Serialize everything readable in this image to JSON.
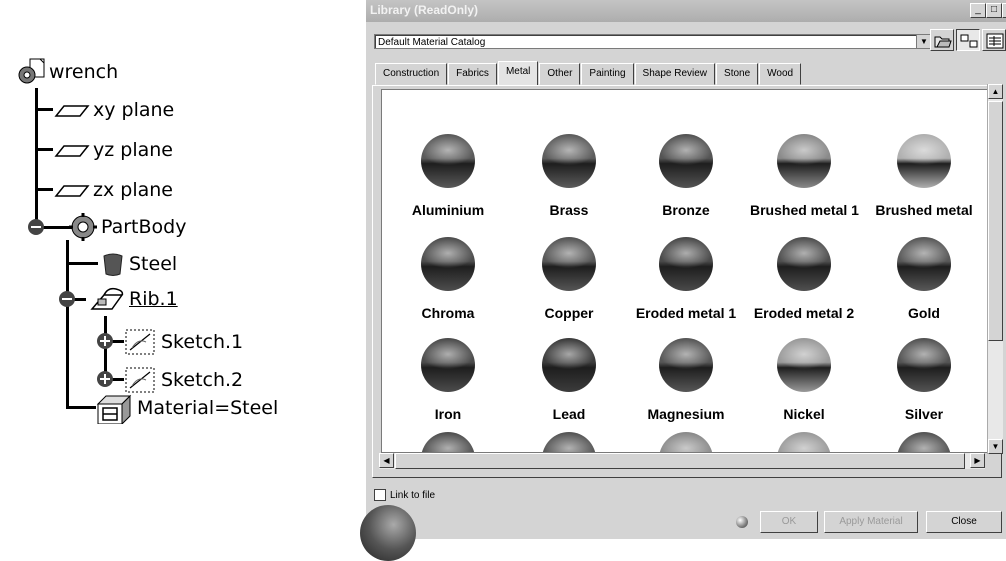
{
  "tree": {
    "root": "wrench",
    "planes": [
      "xy plane",
      "yz plane",
      "zx plane"
    ],
    "partbody": "PartBody",
    "steel": "Steel",
    "rib": "Rib.1",
    "sketches": [
      "Sketch.1",
      "Sketch.2"
    ],
    "material": "Material=Steel"
  },
  "dialog": {
    "title": "Library (ReadOnly)",
    "catalog": "Default Material Catalog",
    "tabs": [
      "Construction",
      "Fabrics",
      "Metal",
      "Other",
      "Painting",
      "Shape Review",
      "Stone",
      "Wood"
    ],
    "active_tab": "Metal",
    "materials": [
      {
        "name": "Aluminium",
        "color": "#5a5a5a"
      },
      {
        "name": "Brass",
        "color": "#5c5c5c"
      },
      {
        "name": "Bronze",
        "color": "#545454"
      },
      {
        "name": "Brushed metal 1",
        "color": "#8a8a8a"
      },
      {
        "name": "Brushed metal",
        "color": "#b0b0b0"
      },
      {
        "name": "Chroma",
        "color": "#4e4e4e"
      },
      {
        "name": "Copper",
        "color": "#565656"
      },
      {
        "name": "Eroded metal 1",
        "color": "#4a4a4a"
      },
      {
        "name": "Eroded metal 2",
        "color": "#505050"
      },
      {
        "name": "Gold",
        "color": "#595959"
      },
      {
        "name": "Iron",
        "color": "#4c4c4c"
      },
      {
        "name": "Lead",
        "color": "#3c3c3c"
      },
      {
        "name": "Magnesium",
        "color": "#575757"
      },
      {
        "name": "Nickel",
        "color": "#9a9a9a"
      },
      {
        "name": "Silver",
        "color": "#545454"
      },
      {
        "name": "",
        "color": "#505050"
      },
      {
        "name": "",
        "color": "#555555"
      },
      {
        "name": "",
        "color": "#8a8a8a"
      },
      {
        "name": "",
        "color": "#9a9a9a"
      },
      {
        "name": "",
        "color": "#555555"
      }
    ],
    "link_to_file": "Link to file",
    "buttons": {
      "ok": "OK",
      "apply": "Apply Material",
      "close": "Close"
    }
  }
}
